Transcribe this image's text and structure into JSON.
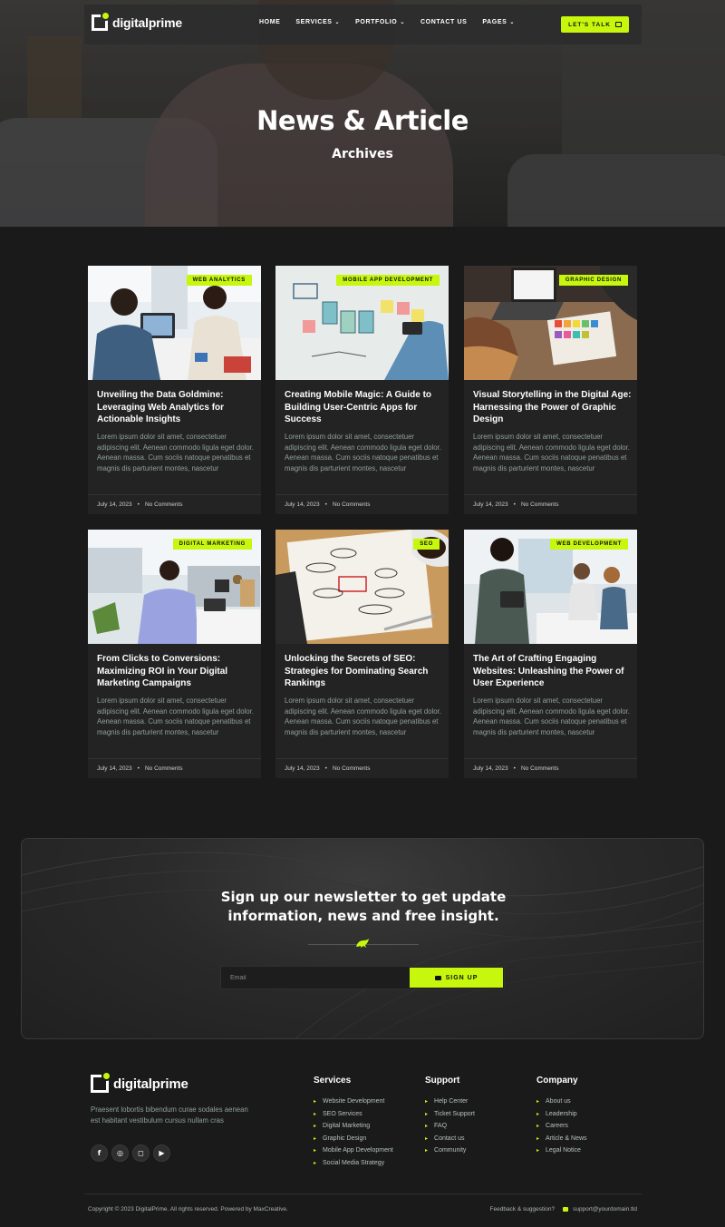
{
  "brand": {
    "name": "digitalprime",
    "accent": "#c6f70c"
  },
  "nav": {
    "items": [
      {
        "label": "HOME",
        "dropdown": false
      },
      {
        "label": "SERVICES",
        "dropdown": true
      },
      {
        "label": "PORTFOLIO",
        "dropdown": true
      },
      {
        "label": "CONTACT US",
        "dropdown": false
      },
      {
        "label": "PAGES",
        "dropdown": true
      }
    ],
    "cta": "LET'S TALK"
  },
  "hero": {
    "title": "News & Article",
    "subtitle": "Archives"
  },
  "posts": [
    {
      "tag": "WEB ANALYTICS",
      "title": "Unveiling the Data Goldmine: Leveraging Web Analytics for Actionable Insights",
      "excerpt": "Lorem ipsum dolor sit amet, consectetuer adipiscing elit. Aenean commodo ligula eget dolor. Aenean massa. Cum sociis natoque penatibus et magnis dis parturient montes, nascetur",
      "date": "July 14, 2023",
      "comments": "No Comments"
    },
    {
      "tag": "MOBILE APP DEVELOPMENT",
      "title": "Creating Mobile Magic: A Guide to Building User-Centric Apps for Success",
      "excerpt": "Lorem ipsum dolor sit amet, consectetuer adipiscing elit. Aenean commodo ligula eget dolor. Aenean massa. Cum sociis natoque penatibus et magnis dis parturient montes, nascetur",
      "date": "July 14, 2023",
      "comments": "No Comments"
    },
    {
      "tag": "GRAPHIC DESIGN",
      "title": "Visual Storytelling in the Digital Age: Harnessing the Power of Graphic Design",
      "excerpt": "Lorem ipsum dolor sit amet, consectetuer adipiscing elit. Aenean commodo ligula eget dolor. Aenean massa. Cum sociis natoque penatibus et magnis dis parturient montes, nascetur",
      "date": "July 14, 2023",
      "comments": "No Comments"
    },
    {
      "tag": "DIGITAL MARKETING",
      "title": "From Clicks to Conversions: Maximizing ROI in Your Digital Marketing Campaigns",
      "excerpt": "Lorem ipsum dolor sit amet, consectetuer adipiscing elit. Aenean commodo ligula eget dolor. Aenean massa. Cum sociis natoque penatibus et magnis dis parturient montes, nascetur",
      "date": "July 14, 2023",
      "comments": "No Comments"
    },
    {
      "tag": "SEO",
      "title": "Unlocking the Secrets of SEO: Strategies for Dominating Search Rankings",
      "excerpt": "Lorem ipsum dolor sit amet, consectetuer adipiscing elit. Aenean commodo ligula eget dolor. Aenean massa. Cum sociis natoque penatibus et magnis dis parturient montes, nascetur",
      "date": "July 14, 2023",
      "comments": "No Comments"
    },
    {
      "tag": "WEB DEVELOPMENT",
      "title": "The Art of Crafting Engaging Websites: Unleashing the Power of User Experience",
      "excerpt": "Lorem ipsum dolor sit amet, consectetuer adipiscing elit. Aenean commodo ligula eget dolor. Aenean massa. Cum sociis natoque penatibus et magnis dis parturient montes, nascetur",
      "date": "July 14, 2023",
      "comments": "No Comments"
    }
  ],
  "newsletter": {
    "title_line1": "Sign up our newsletter to get update",
    "title_line2": "information, news and free insight.",
    "placeholder": "Email",
    "button": "SIGN UP"
  },
  "footer": {
    "description": "Praesent lobortis bibendum curae sodales aenean est habitant vestibulum cursus nullam cras",
    "socials": [
      "facebook-icon",
      "dribbble-icon",
      "instagram-icon",
      "youtube-icon"
    ],
    "columns": [
      {
        "heading": "Services",
        "links": [
          "Website Development",
          "SEO Services",
          "Digital Marketing",
          "Graphic Design",
          "Mobile App Development",
          "Social Media Strategy"
        ]
      },
      {
        "heading": "Support",
        "links": [
          "Help Center",
          "Ticket Support",
          "FAQ",
          "Contact us",
          "Community"
        ]
      },
      {
        "heading": "Company",
        "links": [
          "About us",
          "Leadership",
          "Careers",
          "Article & News",
          "Legal Notice"
        ]
      }
    ],
    "copyright": "Copyright © 2023 DigitalPrime. All rights reserved. Powered by MaxCreative.",
    "feedback_label": "Feedback & suggestion?",
    "feedback_email": "support@yourdomain.tld"
  }
}
